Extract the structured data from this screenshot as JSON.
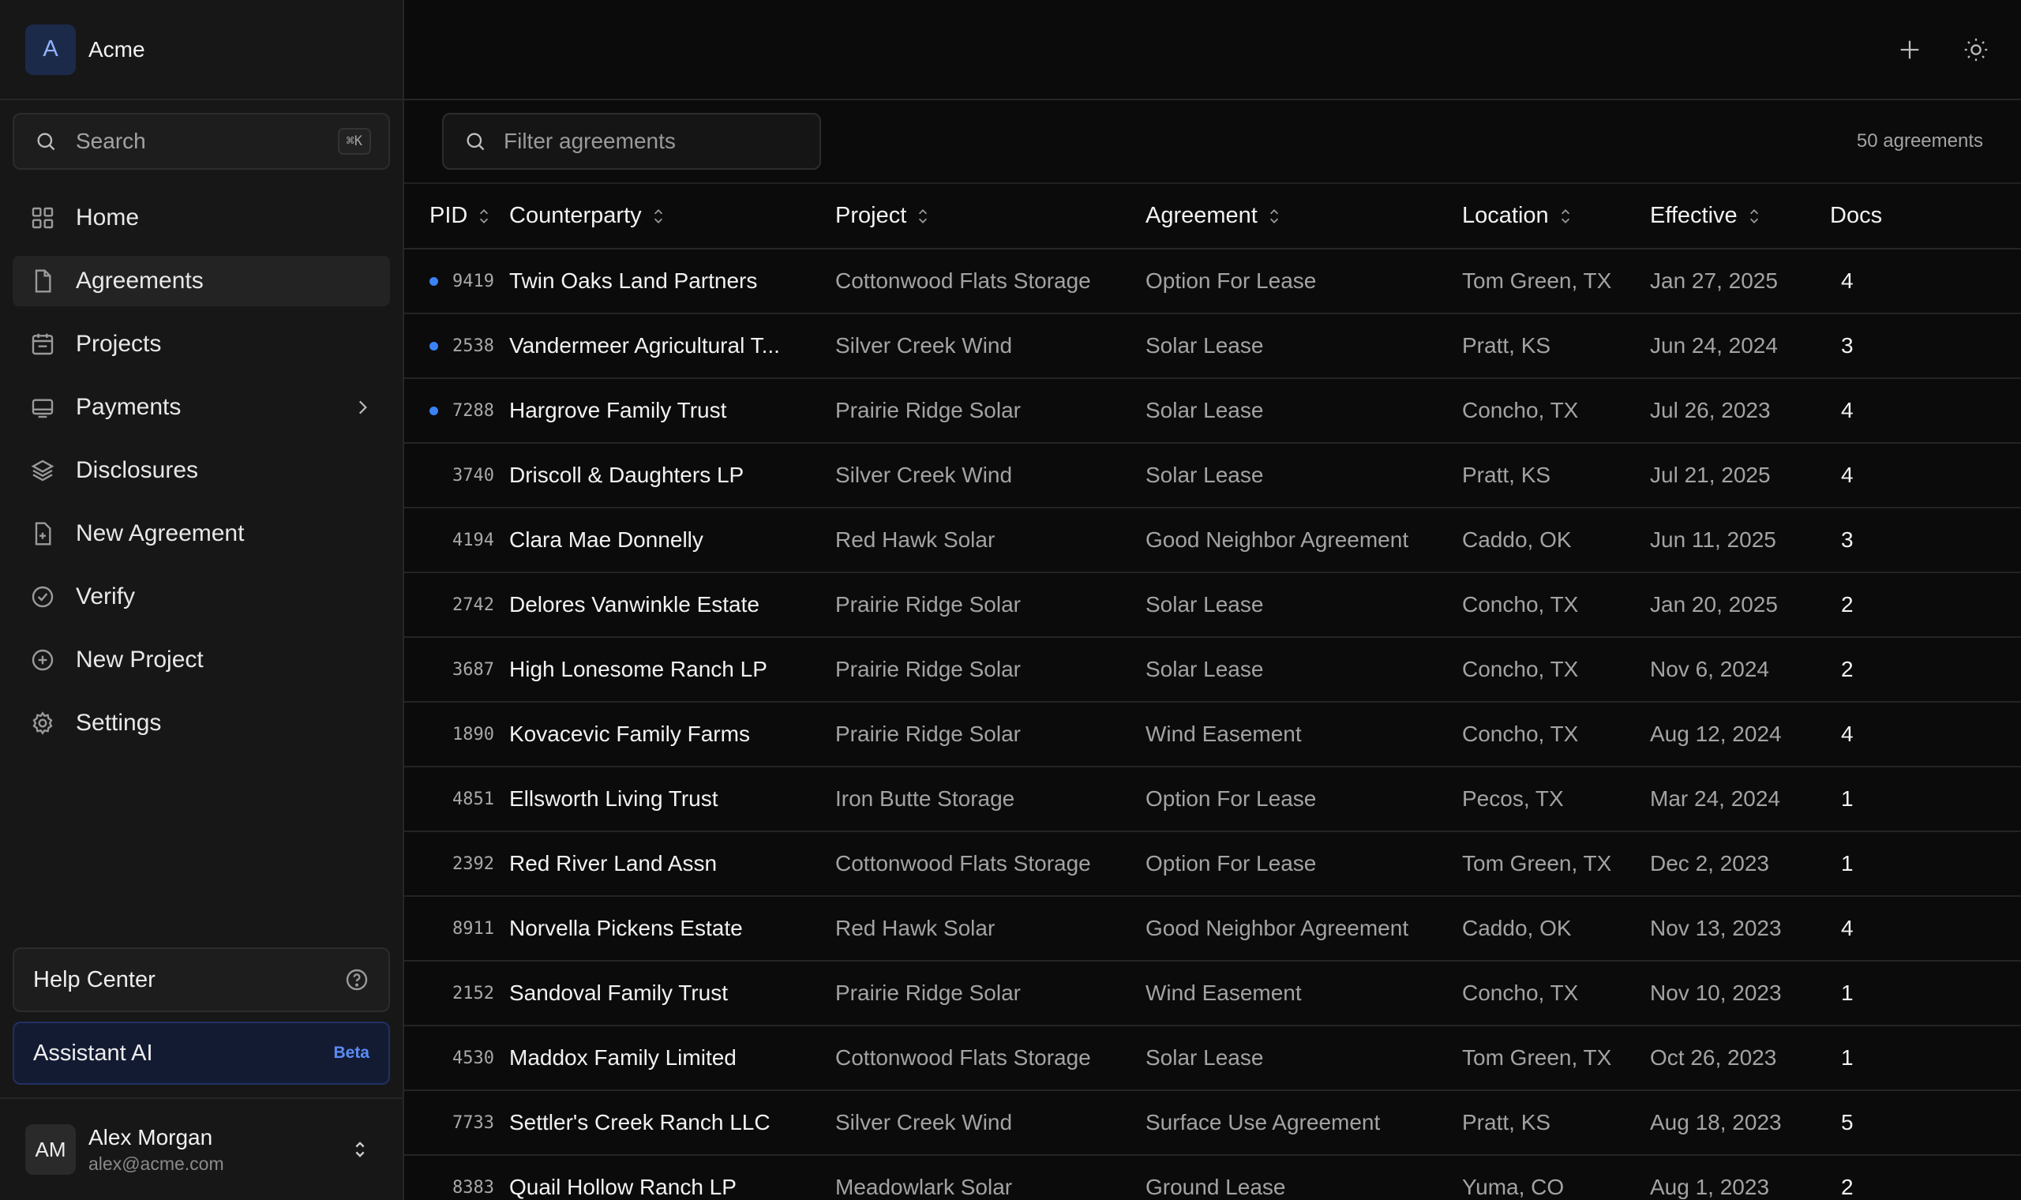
{
  "brand": {
    "logo_letter": "A",
    "name": "Acme"
  },
  "search": {
    "label": "Search",
    "shortcut": "⌘K"
  },
  "nav": [
    {
      "label": "Home",
      "icon": "grid-icon",
      "active": false
    },
    {
      "label": "Agreements",
      "icon": "file-icon",
      "active": true
    },
    {
      "label": "Projects",
      "icon": "calendar-icon",
      "active": false
    },
    {
      "label": "Payments",
      "icon": "wallet-icon",
      "active": false,
      "has_chevron": true
    },
    {
      "label": "Disclosures",
      "icon": "layers-icon",
      "active": false
    },
    {
      "label": "New Agreement",
      "icon": "file-plus-icon",
      "active": false
    },
    {
      "label": "Verify",
      "icon": "check-circle-icon",
      "active": false
    },
    {
      "label": "New Project",
      "icon": "plus-circle-icon",
      "active": false
    },
    {
      "label": "Settings",
      "icon": "gear-icon",
      "active": false
    }
  ],
  "help": {
    "label": "Help Center"
  },
  "assistant": {
    "label": "Assistant AI",
    "badge": "Beta"
  },
  "user": {
    "initials": "AM",
    "name": "Alex Morgan",
    "email": "alex@acme.com"
  },
  "toolbar": {
    "filter_placeholder": "Filter agreements",
    "count": "50 agreements"
  },
  "table": {
    "columns": [
      "PID",
      "Counterparty",
      "Project",
      "Agreement",
      "Location",
      "Effective",
      "Docs"
    ],
    "sortable": [
      true,
      true,
      true,
      true,
      true,
      true,
      false
    ],
    "rows": [
      {
        "pid": "9419",
        "dot": true,
        "counterparty": "Twin Oaks Land Partners",
        "project": "Cottonwood Flats Storage",
        "agreement": "Option For Lease",
        "location": "Tom Green, TX",
        "effective": "Jan 27, 2025",
        "docs": "4"
      },
      {
        "pid": "2538",
        "dot": true,
        "counterparty": "Vandermeer Agricultural T...",
        "project": "Silver Creek Wind",
        "agreement": "Solar Lease",
        "location": "Pratt, KS",
        "effective": "Jun 24, 2024",
        "docs": "3"
      },
      {
        "pid": "7288",
        "dot": true,
        "counterparty": "Hargrove Family Trust",
        "project": "Prairie Ridge Solar",
        "agreement": "Solar Lease",
        "location": "Concho, TX",
        "effective": "Jul 26, 2023",
        "docs": "4"
      },
      {
        "pid": "3740",
        "dot": false,
        "counterparty": "Driscoll & Daughters LP",
        "project": "Silver Creek Wind",
        "agreement": "Solar Lease",
        "location": "Pratt, KS",
        "effective": "Jul 21, 2025",
        "docs": "4"
      },
      {
        "pid": "4194",
        "dot": false,
        "counterparty": "Clara Mae Donnelly",
        "project": "Red Hawk Solar",
        "agreement": "Good Neighbor Agreement",
        "location": "Caddo, OK",
        "effective": "Jun 11, 2025",
        "docs": "3"
      },
      {
        "pid": "2742",
        "dot": false,
        "counterparty": "Delores Vanwinkle Estate",
        "project": "Prairie Ridge Solar",
        "agreement": "Solar Lease",
        "location": "Concho, TX",
        "effective": "Jan 20, 2025",
        "docs": "2"
      },
      {
        "pid": "3687",
        "dot": false,
        "counterparty": "High Lonesome Ranch LP",
        "project": "Prairie Ridge Solar",
        "agreement": "Solar Lease",
        "location": "Concho, TX",
        "effective": "Nov 6, 2024",
        "docs": "2"
      },
      {
        "pid": "1890",
        "dot": false,
        "counterparty": "Kovacevic Family Farms",
        "project": "Prairie Ridge Solar",
        "agreement": "Wind Easement",
        "location": "Concho, TX",
        "effective": "Aug 12, 2024",
        "docs": "4"
      },
      {
        "pid": "4851",
        "dot": false,
        "counterparty": "Ellsworth Living Trust",
        "project": "Iron Butte Storage",
        "agreement": "Option For Lease",
        "location": "Pecos, TX",
        "effective": "Mar 24, 2024",
        "docs": "1"
      },
      {
        "pid": "2392",
        "dot": false,
        "counterparty": "Red River Land Assn",
        "project": "Cottonwood Flats Storage",
        "agreement": "Option For Lease",
        "location": "Tom Green, TX",
        "effective": "Dec 2, 2023",
        "docs": "1"
      },
      {
        "pid": "8911",
        "dot": false,
        "counterparty": "Norvella Pickens Estate",
        "project": "Red Hawk Solar",
        "agreement": "Good Neighbor Agreement",
        "location": "Caddo, OK",
        "effective": "Nov 13, 2023",
        "docs": "4"
      },
      {
        "pid": "2152",
        "dot": false,
        "counterparty": "Sandoval Family Trust",
        "project": "Prairie Ridge Solar",
        "agreement": "Wind Easement",
        "location": "Concho, TX",
        "effective": "Nov 10, 2023",
        "docs": "1"
      },
      {
        "pid": "4530",
        "dot": false,
        "counterparty": "Maddox Family Limited",
        "project": "Cottonwood Flats Storage",
        "agreement": "Solar Lease",
        "location": "Tom Green, TX",
        "effective": "Oct 26, 2023",
        "docs": "1"
      },
      {
        "pid": "7733",
        "dot": false,
        "counterparty": "Settler's Creek Ranch LLC",
        "project": "Silver Creek Wind",
        "agreement": "Surface Use Agreement",
        "location": "Pratt, KS",
        "effective": "Aug 18, 2023",
        "docs": "5"
      },
      {
        "pid": "8383",
        "dot": false,
        "counterparty": "Quail Hollow Ranch LP",
        "project": "Meadowlark Solar",
        "agreement": "Ground Lease",
        "location": "Yuma, CO",
        "effective": "Aug 1, 2023",
        "docs": "2"
      }
    ]
  },
  "colors": {
    "accent": "#3b82f6",
    "background": "#0b0b0b",
    "sidebar": "#171717",
    "beta": "#5b8cf5"
  }
}
